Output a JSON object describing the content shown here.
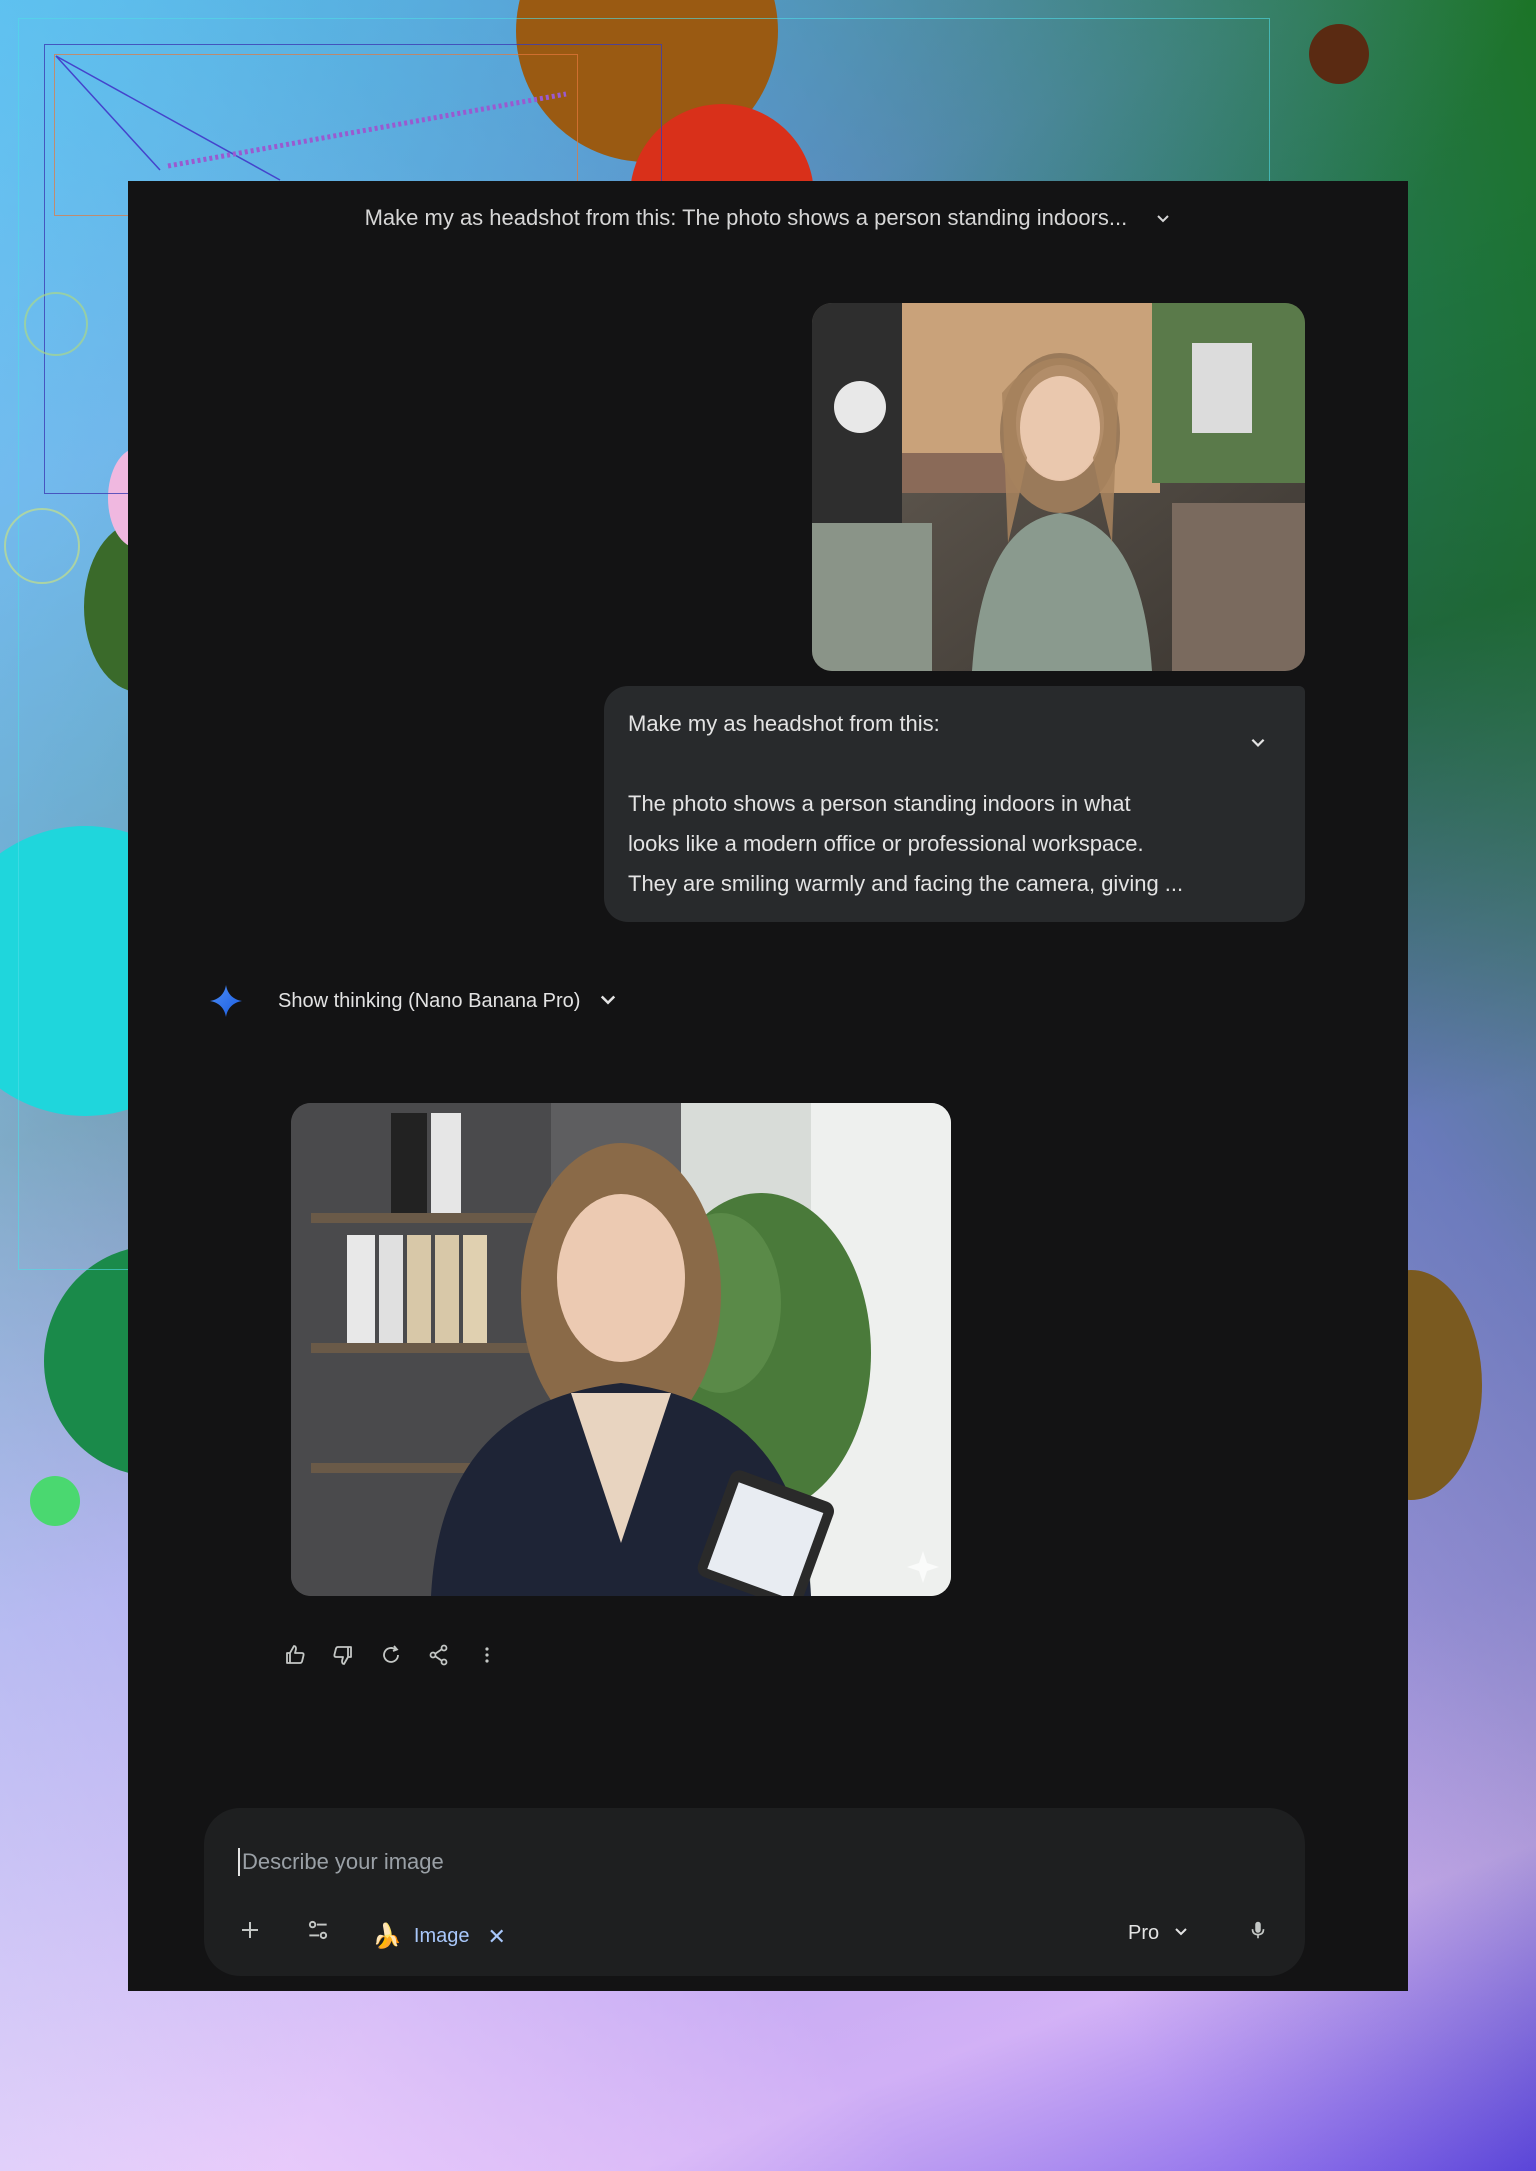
{
  "header": {
    "title": "Make my as headshot from this: The photo shows a person standing indoors..."
  },
  "user_message": {
    "line1": "Make my as headshot from this:",
    "body_lines": [
      "The photo shows a person standing indoors in what",
      "looks like a modern office or professional workspace.",
      "They are smiling warmly and facing the camera, giving ..."
    ]
  },
  "response": {
    "thinking_label": "Show thinking (Nano Banana Pro)"
  },
  "composer": {
    "placeholder": "Describe your image",
    "tool_chip": "Image",
    "model": "Pro"
  },
  "icons": {
    "spark": "gemini-spark-icon",
    "like": "thumbs-up-icon",
    "dislike": "thumbs-down-icon",
    "regenerate": "refresh-icon",
    "share": "share-icon",
    "more": "more-vert-icon",
    "add": "plus-icon",
    "tools": "tune-icon",
    "mic": "mic-icon"
  },
  "colors": {
    "app_bg": "#131314",
    "bubble_bg": "#282a2c",
    "composer_bg": "#1e1f20",
    "chip_text": "#a8c7fa",
    "spark_blue": "#4c8df6"
  }
}
